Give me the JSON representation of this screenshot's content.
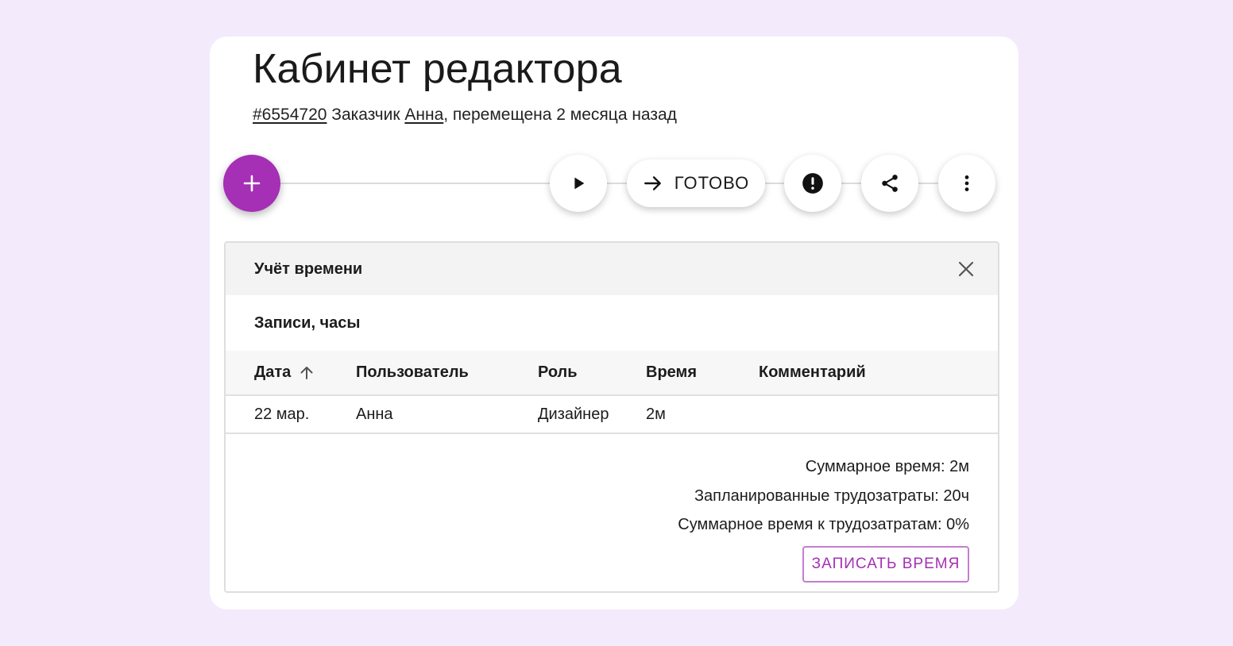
{
  "header": {
    "title": "Кабинет редактора",
    "task_id": "#6554720",
    "customer_label": "Заказчик",
    "customer_name": "Анна",
    "moved_text": ", перемещена 2 месяца назад"
  },
  "actions": {
    "done_label": "ГОТОВО"
  },
  "panel": {
    "title": "Учёт времени",
    "section_title": "Записи, часы",
    "columns": {
      "date": "Дата",
      "user": "Пользователь",
      "role": "Роль",
      "time": "Время",
      "comment": "Комментарий"
    },
    "rows": [
      {
        "date": "22 мар.",
        "user": "Анна",
        "role": "Дизайнер",
        "time": "2м",
        "comment": ""
      }
    ],
    "summary": {
      "total": "Суммарное время: 2м",
      "planned": "Запланированные трудозатраты: 20ч",
      "ratio": "Суммарное время к трудозатратам: 0%"
    },
    "record_button": "ЗАПИСАТЬ ВРЕМЯ"
  },
  "colors": {
    "accent": "#a52fb5",
    "background": "#f3eafc",
    "card": "#ffffff"
  },
  "icons": {
    "fab": "plus-icon",
    "play": "play-icon",
    "done": "arrow-right-icon",
    "alert": "alert-icon",
    "share": "share-icon",
    "more": "more-vert-icon",
    "close": "close-icon",
    "sort": "arrow-up-icon"
  }
}
